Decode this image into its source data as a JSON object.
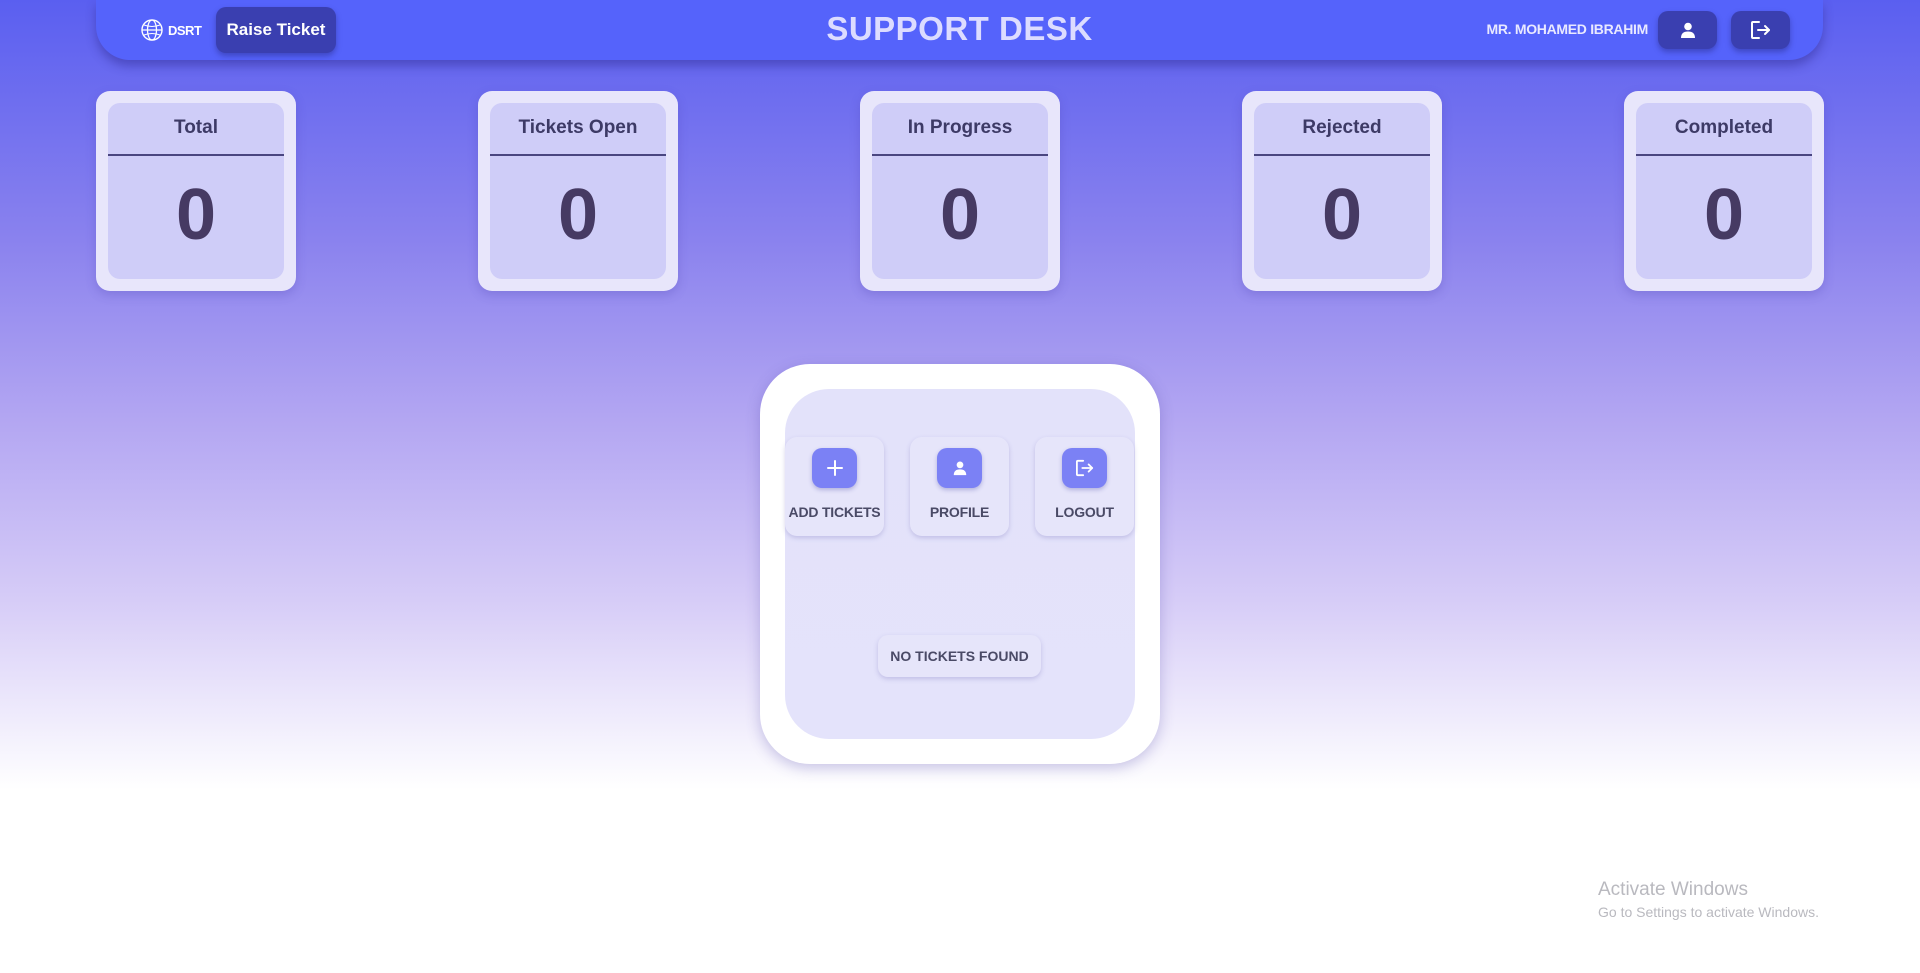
{
  "header": {
    "logo_text": "DSRT",
    "raise_ticket_label": "Raise Ticket",
    "title": "SUPPORT DESK",
    "user_name": "MR. MOHAMED IBRAHIM",
    "profile_icon": "user-icon",
    "logout_icon": "logout-icon"
  },
  "stats": [
    {
      "label": "Total",
      "value": "0"
    },
    {
      "label": "Tickets Open",
      "value": "0"
    },
    {
      "label": "In Progress",
      "value": "0"
    },
    {
      "label": "Rejected",
      "value": "0"
    },
    {
      "label": "Completed",
      "value": "0"
    }
  ],
  "panel": {
    "actions": [
      {
        "label": "ADD TICKETS",
        "icon": "plus-icon"
      },
      {
        "label": "PROFILE",
        "icon": "user-icon"
      },
      {
        "label": "LOGOUT",
        "icon": "logout-icon"
      }
    ],
    "empty_message": "NO TICKETS FOUND"
  },
  "watermark": {
    "title": "Activate Windows",
    "subtitle": "Go to Settings to activate Windows."
  },
  "colors": {
    "header": "#5563fb",
    "button_dark": "#3a3fb0",
    "card_outer": "#e8e6fb",
    "card_inner": "#cfcdf8",
    "tile_icon": "#7b81f5"
  }
}
